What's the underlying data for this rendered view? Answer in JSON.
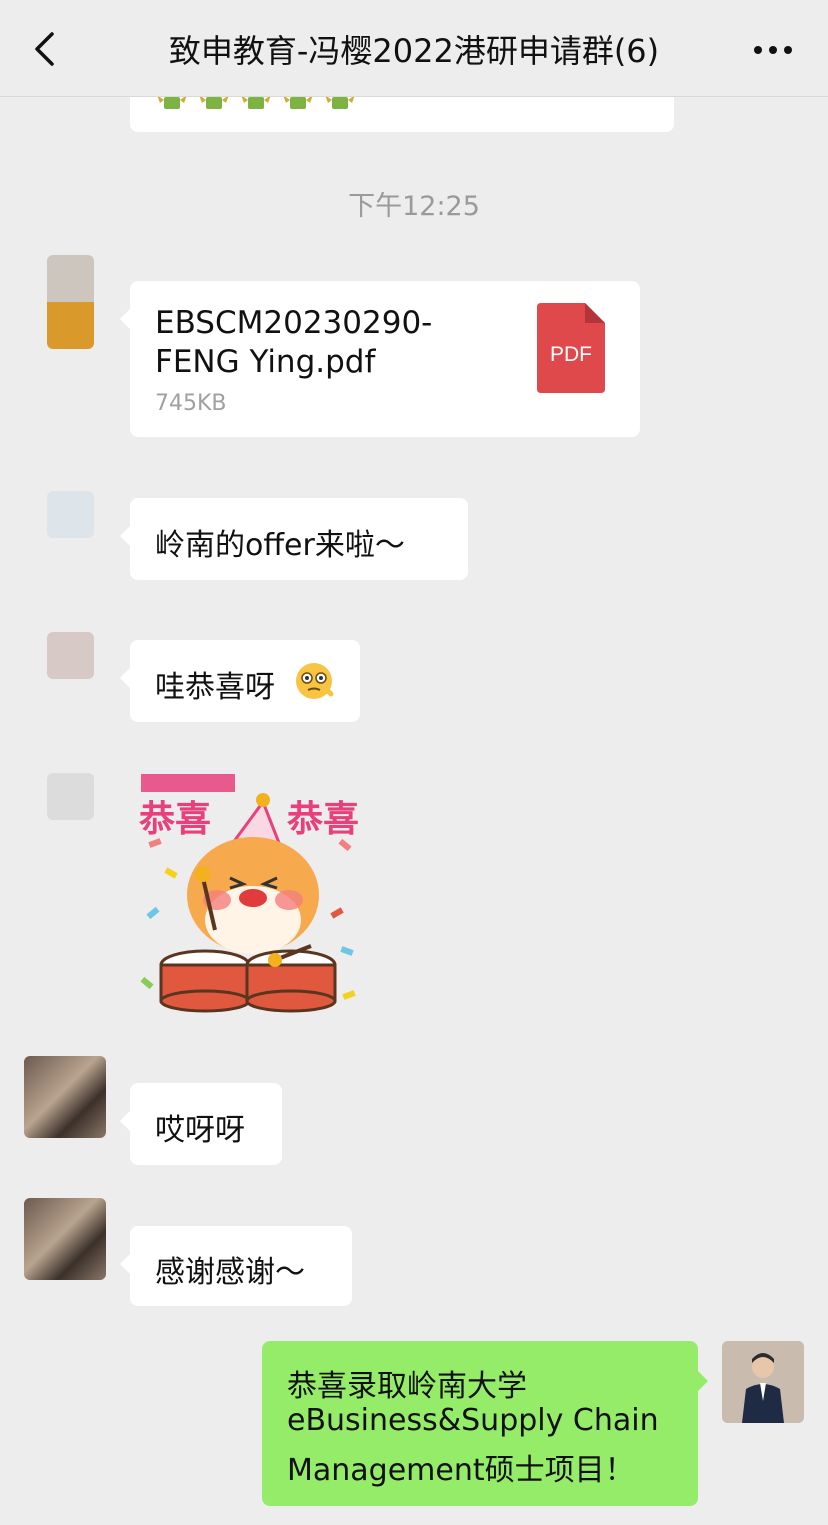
{
  "header": {
    "title": "致申教育-冯樱2022港研申请群(6)",
    "back_icon": "chevron-left-icon",
    "more_icon": "more-dots-icon"
  },
  "top_partial_message": {
    "emoji_icon": "money-wings-icon",
    "count": 5
  },
  "timestamp": "下午12:25",
  "messages": [
    {
      "type": "file",
      "file_name_line1": "EBSCM20230290-",
      "file_name_line2": "FENG Ying.pdf",
      "file_size": "745KB",
      "file_icon_label": "PDF"
    },
    {
      "type": "text",
      "text": "岭南的offer来啦～"
    },
    {
      "type": "text",
      "text": "哇恭喜呀",
      "emoji": "monocle-face-icon"
    },
    {
      "type": "sticker",
      "left_caption": "恭喜",
      "right_caption": "恭喜"
    },
    {
      "type": "text",
      "text": "哎呀呀"
    },
    {
      "type": "text",
      "text": "感谢感谢～"
    },
    {
      "type": "text",
      "self": true,
      "line1": "恭喜录取岭南大学",
      "line2": "eBusiness&Supply Chain",
      "line3": "Management硕士项目！"
    }
  ],
  "colors": {
    "background": "#ededed",
    "bubble_incoming": "#ffffff",
    "bubble_outgoing": "#95ec69",
    "pdf_red": "#e0494b",
    "sticker_pink": "#e8407a"
  }
}
